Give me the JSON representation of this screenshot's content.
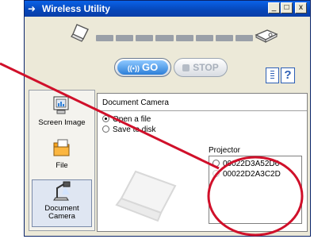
{
  "window": {
    "title": "Wireless Utility"
  },
  "titlebar": {
    "minimize": "_",
    "maximize": "□",
    "close": "x"
  },
  "toolbar": {
    "go_label": "GO",
    "go_signal": "((•))",
    "stop_label": "STOP",
    "help_label": "?"
  },
  "modes": [
    {
      "label": "Screen Image",
      "icon": "screen-image-icon"
    },
    {
      "label": "File",
      "icon": "folder-icon"
    },
    {
      "label": "Document\nCamera",
      "icon": "document-camera-icon"
    }
  ],
  "content": {
    "title": "Document Camera",
    "options": [
      "Open a file",
      "Save to disk"
    ],
    "selected_option": "Open a file",
    "projector_label": "Projector",
    "projectors": [
      "00022D3A52D6",
      "00022D2A3C2D"
    ]
  },
  "colors": {
    "titlebar": "#0646b8",
    "annotation": "#d0102a",
    "go_accent": "#2d7fd8"
  }
}
